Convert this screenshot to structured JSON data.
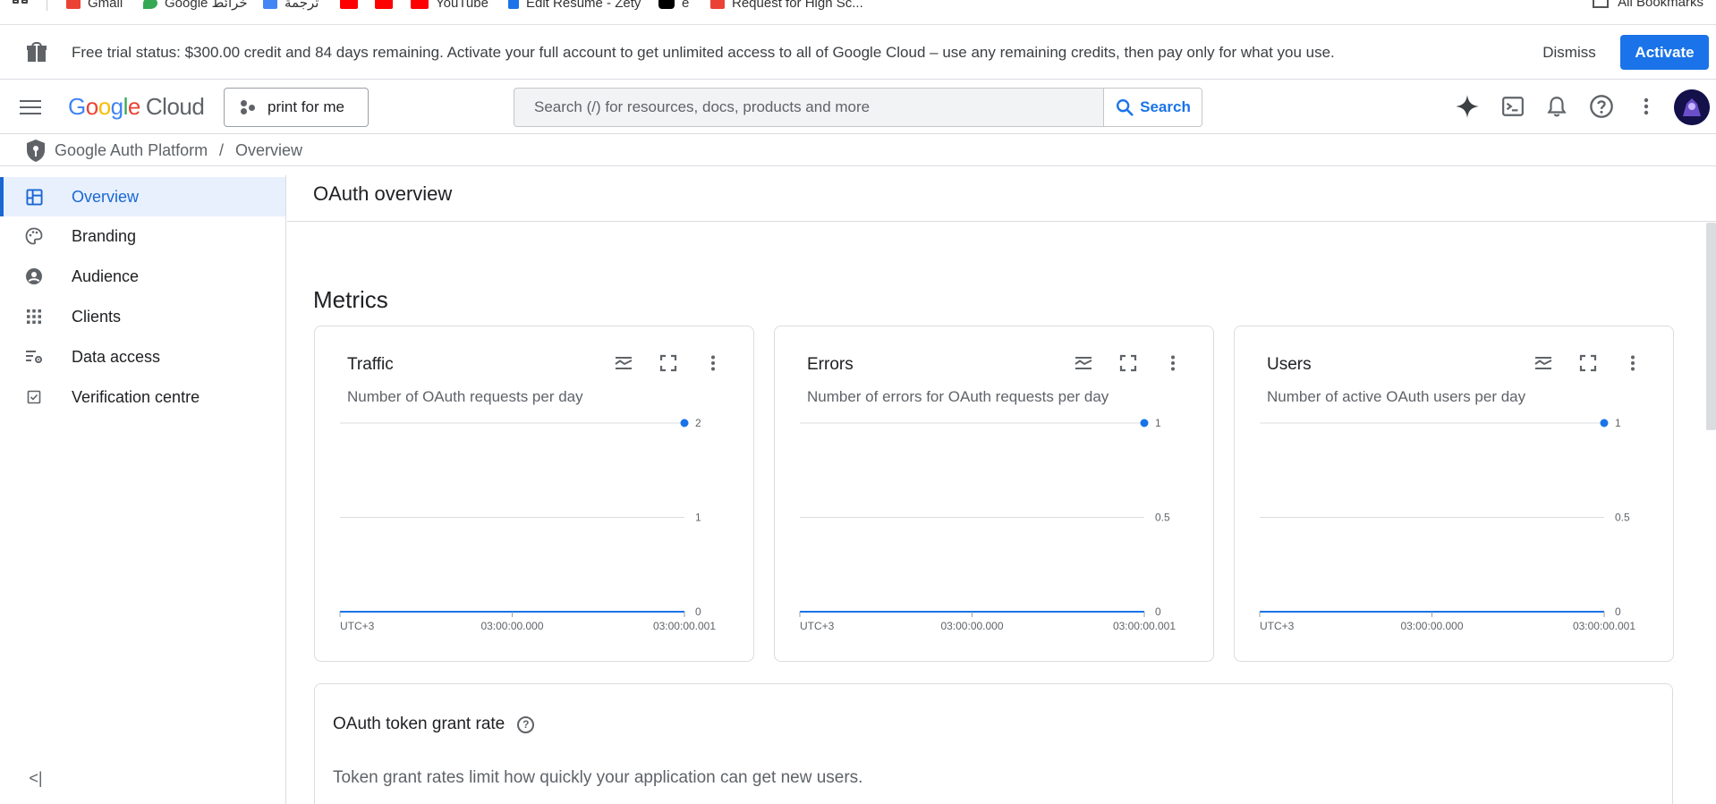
{
  "bookmarks": {
    "items": [
      {
        "label": "Gmail",
        "color": "#ea4335"
      },
      {
        "label": "Google خرائط",
        "color": "#34a853"
      },
      {
        "label": "ترجمة",
        "color": "#4285f4"
      },
      {
        "label": "",
        "color": "#ff0000"
      },
      {
        "label": "",
        "color": "#ff0000"
      },
      {
        "label": "YouTube",
        "color": "#ff0000"
      },
      {
        "label": "Edit Resume - Zety",
        "color": "#1a73e8"
      },
      {
        "label": "e",
        "color": "#000000"
      },
      {
        "label": "Request for High Sc...",
        "color": "#ea4335"
      }
    ],
    "all_label": "All Bookmarks"
  },
  "banner": {
    "text": "Free trial status: $300.00 credit and 84 days remaining. Activate your full account to get unlimited access to all of Google Cloud – use any remaining credits, then pay only for what you use.",
    "dismiss": "Dismiss",
    "activate": "Activate"
  },
  "header": {
    "logo_google": "Google",
    "logo_cloud": "Cloud",
    "project": "print for me",
    "search_placeholder": "Search (/) for resources, docs, products and more",
    "search_button": "Search"
  },
  "breadcrumb": {
    "root": "Google Auth Platform",
    "separator": "/",
    "current": "Overview"
  },
  "sidebar": {
    "items": [
      {
        "label": "Overview",
        "icon": "dashboard-icon",
        "active": true
      },
      {
        "label": "Branding",
        "icon": "palette-icon",
        "active": false
      },
      {
        "label": "Audience",
        "icon": "person-circle-icon",
        "active": false
      },
      {
        "label": "Clients",
        "icon": "grid-dots-icon",
        "active": false
      },
      {
        "label": "Data access",
        "icon": "data-settings-icon",
        "active": false
      },
      {
        "label": "Verification centre",
        "icon": "check-box-icon",
        "active": false
      }
    ],
    "collapse_glyph": "<|"
  },
  "main": {
    "title": "OAuth overview",
    "metrics_title": "Metrics",
    "cards": [
      {
        "title": "Traffic",
        "subtitle": "Number of OAuth requests per day",
        "y_ticks": [
          "2",
          "1",
          "0"
        ],
        "x_ticks": [
          "UTC+3",
          "03:00:00.000",
          "03:00:00.001"
        ],
        "ylim": [
          0,
          2
        ],
        "point_value": 2
      },
      {
        "title": "Errors",
        "subtitle": "Number of errors for OAuth requests per day",
        "y_ticks": [
          "1",
          "0.5",
          "0"
        ],
        "x_ticks": [
          "UTC+3",
          "03:00:00.000",
          "03:00:00.001"
        ],
        "ylim": [
          0,
          1
        ],
        "point_value": 1
      },
      {
        "title": "Users",
        "subtitle": "Number of active OAuth users per day",
        "y_ticks": [
          "1",
          "0.5",
          "0"
        ],
        "x_ticks": [
          "UTC+3",
          "03:00:00.000",
          "03:00:00.001"
        ],
        "ylim": [
          0,
          1
        ],
        "point_value": 1
      }
    ],
    "grant": {
      "title": "OAuth token grant rate",
      "help_glyph": "?",
      "description": "Token grant rates limit how quickly your application can get new users."
    }
  },
  "colors": {
    "accent": "#1a73e8",
    "active_nav_bg": "#e8f0fe",
    "series_line": "#1a73e8"
  }
}
